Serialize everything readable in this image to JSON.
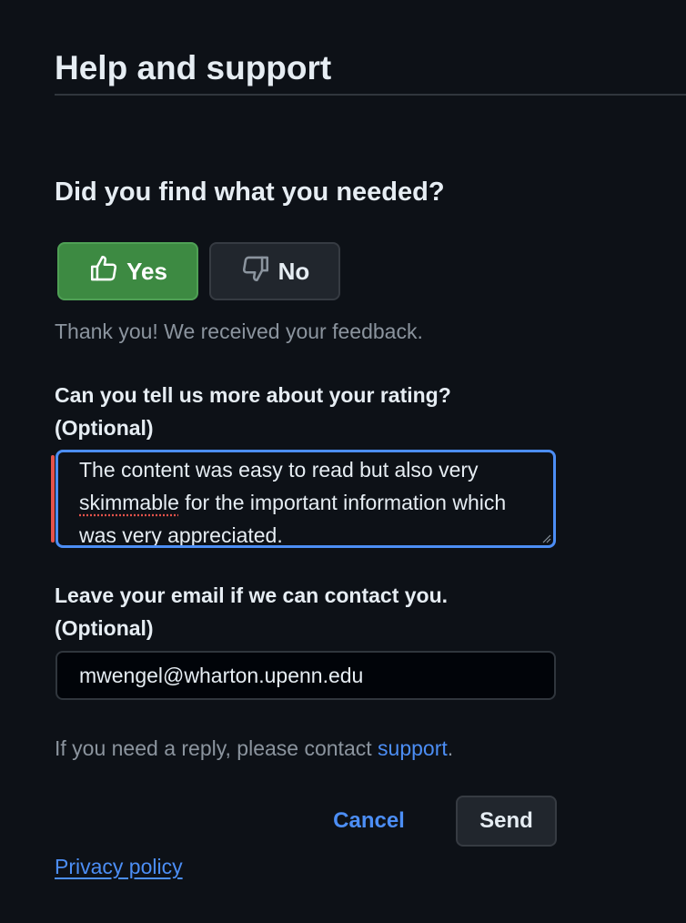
{
  "header": {
    "title": "Help and support"
  },
  "feedback": {
    "question": "Did you find what you needed?",
    "yes_label": "Yes",
    "no_label": "No",
    "selected": "Yes",
    "thanks_message": "Thank you! We received your feedback."
  },
  "rating_details": {
    "label_line1": "Can you tell us more about your rating?",
    "label_line2": "(Optional)",
    "text_part1": "The content was easy to read but also very ",
    "text_misspelled": "skimmable",
    "text_part2": " for the important information which was very appreciated."
  },
  "email": {
    "label_line1": "Leave your email if we can contact you.",
    "label_line2": "(Optional)",
    "value": "mwengel@wharton.upenn.edu"
  },
  "reply_note": {
    "prefix": "If you need a reply, please contact ",
    "link_text": "support",
    "suffix": "."
  },
  "actions": {
    "cancel_label": "Cancel",
    "send_label": "Send"
  },
  "footer": {
    "privacy_label": "Privacy policy"
  },
  "colors": {
    "background": "#0d1117",
    "yes_button": "#3d8a42",
    "accent_link": "#4c8ef5",
    "focus_border": "#4c8ef5",
    "error_bar": "#e5534b"
  },
  "icons": {
    "yes": "thumbs-up-icon",
    "no": "thumbs-down-icon"
  }
}
